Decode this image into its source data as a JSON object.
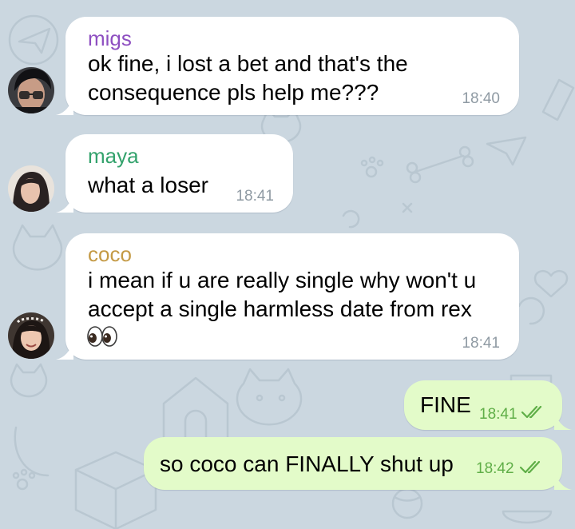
{
  "theme": {
    "in_bubble": "#ffffff",
    "out_bubble": "#e3fbc9",
    "time_in_color": "#8f9aa3",
    "time_out_color": "#5fae47",
    "background": "#cbd7e0"
  },
  "messages": [
    {
      "direction": "incoming",
      "sender": "migs",
      "sender_color": "#8e4fc1",
      "lines": [
        "ok fine, i lost a bet and that's the",
        "consequence pls help me???"
      ],
      "time": "18:40"
    },
    {
      "direction": "incoming",
      "sender": "maya",
      "sender_color": "#33a26c",
      "lines": [
        "what a loser"
      ],
      "time": "18:41"
    },
    {
      "direction": "incoming",
      "sender": "coco",
      "sender_color": "#c49a45",
      "lines": [
        "i mean if u are really single why won't u",
        "accept a single harmless date from rex"
      ],
      "emoji": "eyes-emoji",
      "time": "18:41"
    },
    {
      "direction": "outgoing",
      "lines": [
        "FINE"
      ],
      "time": "18:41",
      "status": "read"
    },
    {
      "direction": "outgoing",
      "lines": [
        "so coco can FINALLY shut up"
      ],
      "time": "18:42",
      "status": "read"
    }
  ]
}
